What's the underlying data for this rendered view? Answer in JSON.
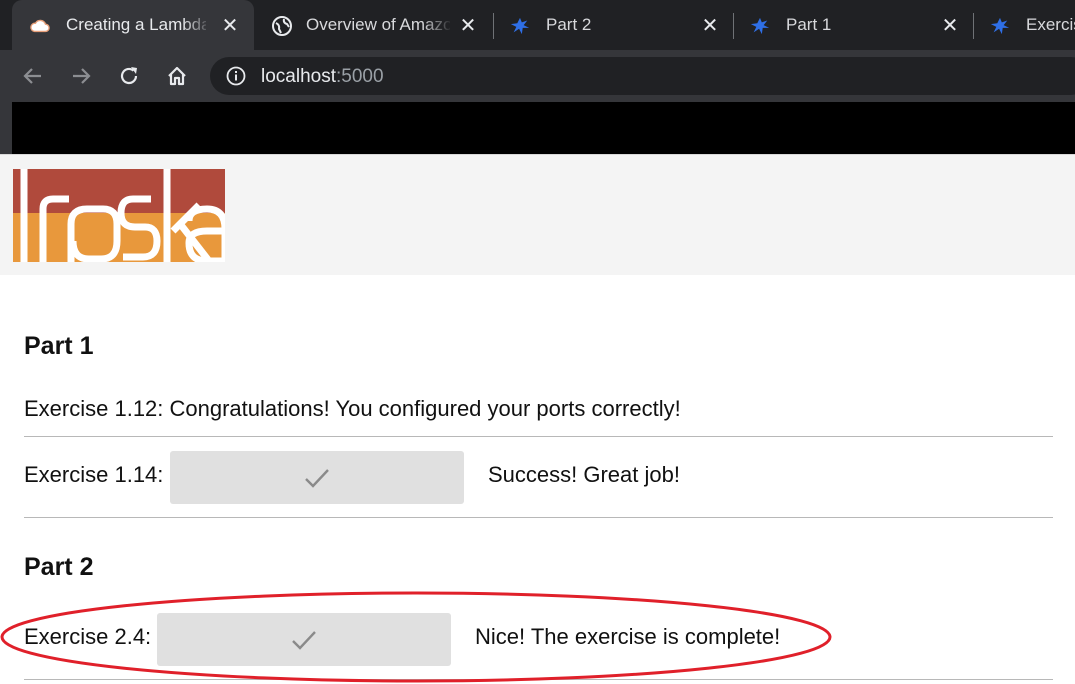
{
  "browser": {
    "tabs": [
      {
        "title": "Creating a Lambda",
        "icon": "cloud-icon",
        "active": true
      },
      {
        "title": "Overview of Amazon",
        "icon": "globe-icon",
        "active": false
      },
      {
        "title": "Part 2",
        "icon": "bug-icon",
        "active": false
      },
      {
        "title": "Part 1",
        "icon": "bug-icon",
        "active": false
      },
      {
        "title": "Exercise",
        "icon": "bug-icon",
        "active": false
      }
    ],
    "url_host": "localhost",
    "url_port": ":5000"
  },
  "page": {
    "sections": [
      {
        "heading": "Part 1",
        "rows": [
          {
            "label": "Exercise 1.12: Congratulations! You configured your ports correctly!"
          },
          {
            "label": "Exercise 1.14:",
            "status": "Success! Great job!"
          }
        ]
      },
      {
        "heading": "Part 2",
        "rows": [
          {
            "label": "Exercise 2.4:",
            "status": "Nice! The exercise is complete!"
          }
        ]
      }
    ]
  },
  "colors": {
    "logo_top": "#b04a3c",
    "logo_bottom": "#e8983c",
    "annotation": "#e0202a"
  }
}
